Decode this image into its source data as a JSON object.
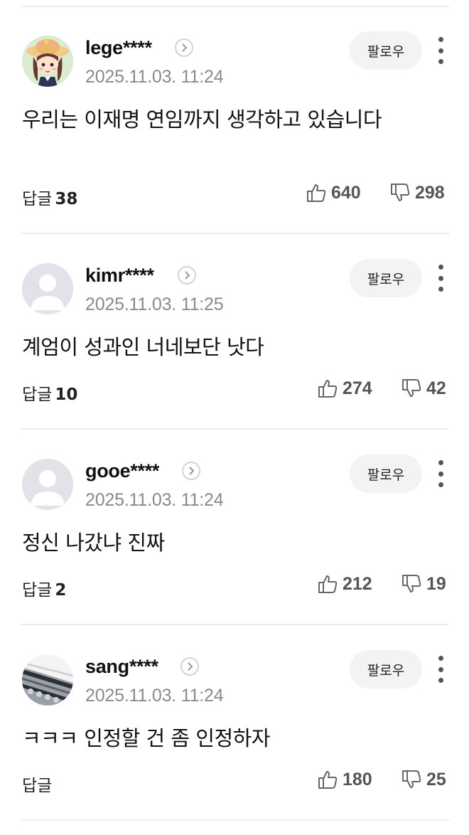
{
  "follow_label": "팔로우",
  "reply_label": "답글",
  "comments": [
    {
      "username": "lege****",
      "date": "2025.11.03. 11:24",
      "text": "우리는 이재명 연임까지 생각하고 있습니다",
      "reply_count": "38",
      "likes": "640",
      "dislikes": "298",
      "avatar": "cartoon-girl-avatar"
    },
    {
      "username": "kimr****",
      "date": "2025.11.03. 11:25",
      "text": "계엄이 성과인 너네보단 낫다",
      "reply_count": "10",
      "likes": "274",
      "dislikes": "42",
      "avatar": "default-avatar"
    },
    {
      "username": "gooe****",
      "date": "2025.11.03. 11:24",
      "text": "정신 나갔냐 진짜",
      "reply_count": "2",
      "likes": "212",
      "dislikes": "19",
      "avatar": "default-avatar"
    },
    {
      "username": "sang****",
      "date": "2025.11.03. 11:24",
      "text": "ㅋㅋㅋ 인정할 건 좀 인정하자",
      "reply_count": "",
      "likes": "180",
      "dislikes": "25",
      "avatar": "photo-avatar"
    }
  ]
}
